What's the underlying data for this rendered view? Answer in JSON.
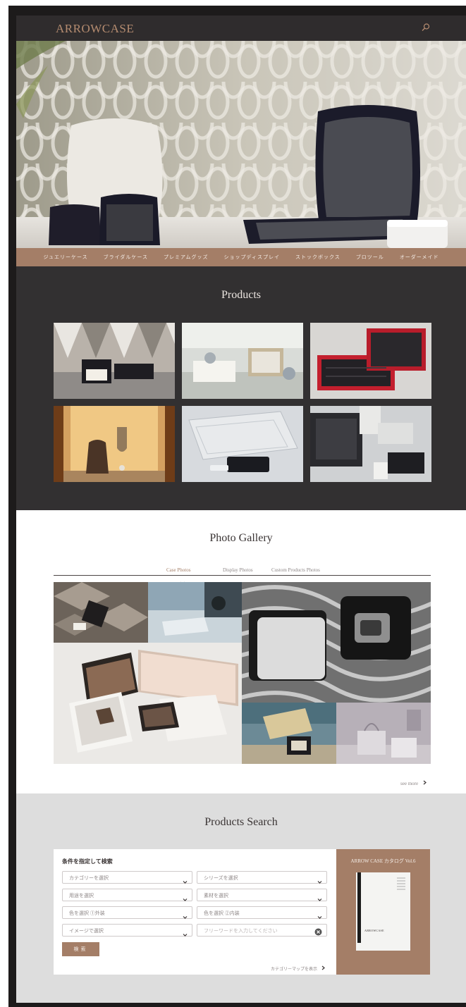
{
  "header": {
    "logo": "ARROWCASE"
  },
  "nav": {
    "items": [
      "ジュエリーケース",
      "ブライダルケース",
      "プレミアムグッズ",
      "ショップディスプレイ",
      "ストックボックス",
      "ブロツール",
      "オーダーメイド"
    ]
  },
  "products": {
    "title": "Products"
  },
  "gallery": {
    "title": "Photo Gallery",
    "tabs": [
      "Case Photos",
      "Display Photos",
      "Custom Products Photos"
    ],
    "see_more": "see more"
  },
  "search": {
    "title": "Products Search",
    "form_heading": "条件を指定して検索",
    "fields": [
      {
        "placeholder": "カテゴリーを選択",
        "type": "select"
      },
      {
        "placeholder": "シリーズを選択",
        "type": "select"
      },
      {
        "placeholder": "用途を選択",
        "type": "select"
      },
      {
        "placeholder": "素材を選択",
        "type": "select"
      },
      {
        "placeholder": "色を選択 ①外装",
        "type": "select"
      },
      {
        "placeholder": "色を選択 ②内装",
        "type": "select"
      },
      {
        "placeholder": "イメージで選択",
        "type": "select"
      },
      {
        "placeholder": "フリーワードを入力してください",
        "type": "text"
      }
    ],
    "submit": "検索",
    "category_map": "カテゴリーマップを表示",
    "catalog_title": "ARROW CASE カタログ Vol.6",
    "catalog_cover_text": "ARROWCASE"
  },
  "colors": {
    "accent": "#a47e67",
    "dark": "#323031",
    "logo": "#b58c70"
  }
}
